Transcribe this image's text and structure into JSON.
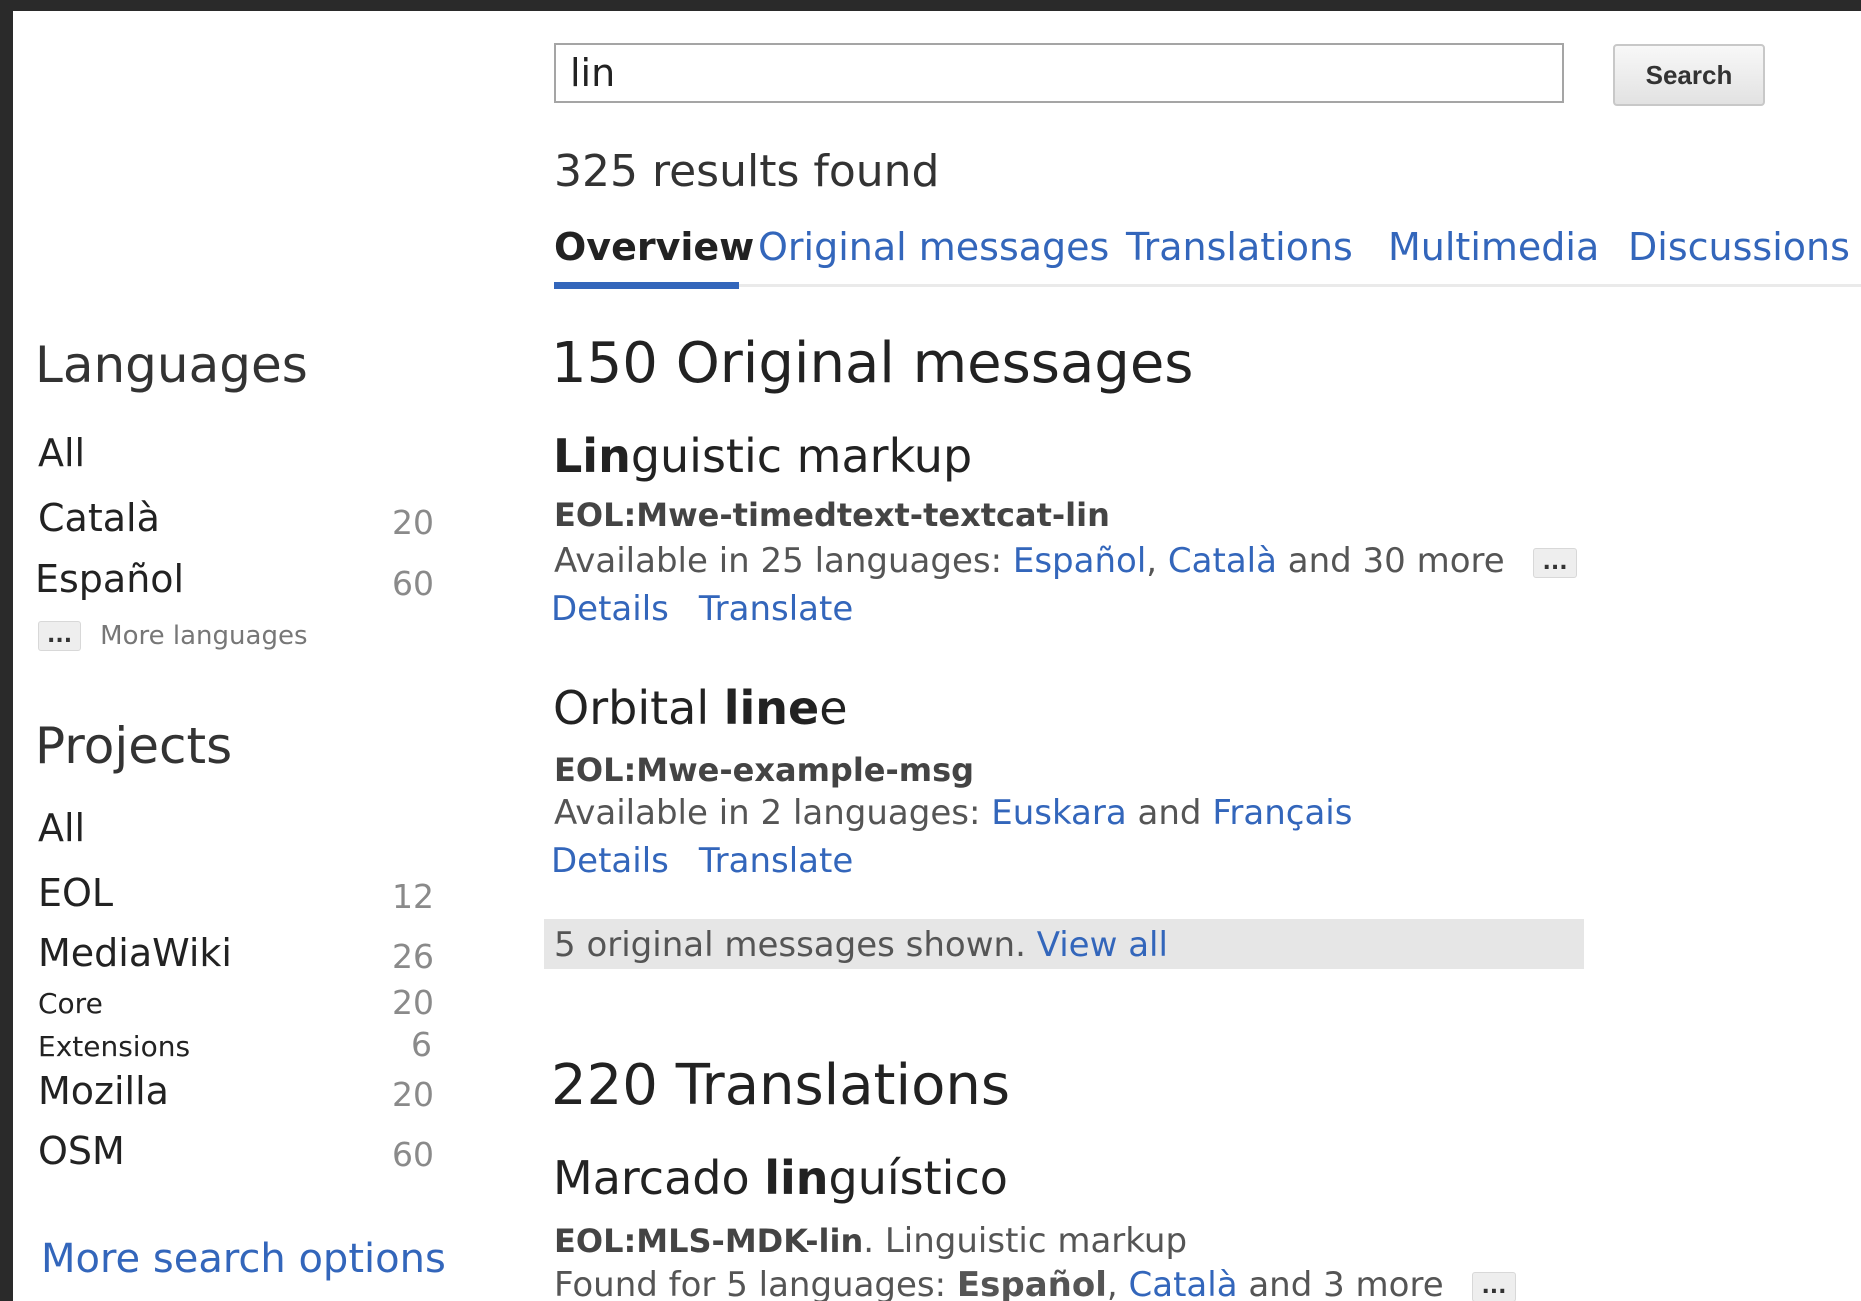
{
  "search": {
    "value": "lin",
    "button_label": "Search"
  },
  "results_count": "325 results found",
  "tabs": [
    {
      "label": "Overview"
    },
    {
      "label": "Original messages"
    },
    {
      "label": "Translations"
    },
    {
      "label": "Multimedia"
    },
    {
      "label": "Discussions"
    }
  ],
  "sidebar": {
    "languages": {
      "heading": "Languages",
      "all": "All",
      "items": [
        {
          "label": "Català",
          "count": "20"
        },
        {
          "label": "Español",
          "count": "60"
        }
      ],
      "more_button": "...",
      "more_label": "More languages"
    },
    "projects": {
      "heading": "Projects",
      "all": "All",
      "items": [
        {
          "label": "EOL",
          "count": "12"
        },
        {
          "label": "MediaWiki",
          "count": "26"
        },
        {
          "label": "Core",
          "count": "20"
        },
        {
          "label": "Extensions",
          "count": "6"
        },
        {
          "label": "Mozilla",
          "count": "20"
        },
        {
          "label": "OSM",
          "count": "60"
        }
      ]
    },
    "more_options": "More search options"
  },
  "originals": {
    "heading": "150 Original messages",
    "results": [
      {
        "title_bold": "Lin",
        "title_rest": "guistic markup",
        "key": "EOL:Mwe-timedtext-textcat-lin",
        "avail_prefix": "Available in 25 languages: ",
        "lang1": "Español",
        "sep": ", ",
        "lang2": "Català",
        "avail_suffix": " and 30 more",
        "more_button": "...",
        "details": "Details",
        "translate": "Translate"
      },
      {
        "title_pre": "Orbital ",
        "title_bold": "line",
        "title_rest": "e",
        "key": "EOL:Mwe-example-msg",
        "avail_prefix": "Available in 2 languages: ",
        "lang1": "Euskara",
        "and": " and ",
        "lang2": "Français",
        "details": "Details",
        "translate": "Translate"
      }
    ],
    "shown_text": "5 original messages shown. ",
    "view_all": "View all"
  },
  "translations": {
    "heading": "220 Translations",
    "results": [
      {
        "title_pre": "Marcado ",
        "title_bold": "lin",
        "title_rest": "guístico",
        "key": "EOL:MLS-MDK-lin",
        "key_suffix": ". Linguistic markup",
        "found_prefix": "Found for 5 languages: ",
        "lang1": "Español",
        "sep": ", ",
        "lang2": "Català",
        "found_suffix": " and 3 more",
        "more_button": "..."
      }
    ]
  }
}
